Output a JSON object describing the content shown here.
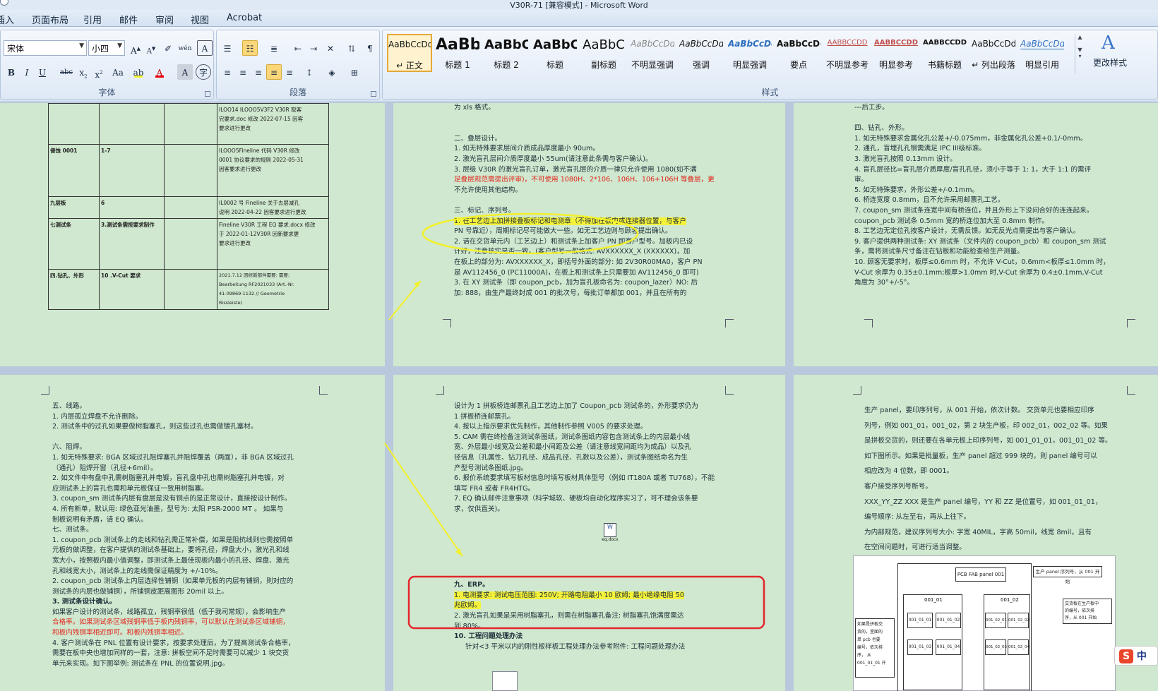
{
  "window": {
    "title": "V30R-71 [兼容模式] - Microsoft Word"
  },
  "tabs": [
    "插入",
    "页面布局",
    "引用",
    "邮件",
    "审阅",
    "视图",
    "Acrobat"
  ],
  "font_group": {
    "font_name": "宋体",
    "font_size": "小四",
    "label": "字体"
  },
  "paragraph_group": {
    "label": "段落"
  },
  "styles_group": {
    "label": "样式",
    "change_styles": "更改样式",
    "items": [
      {
        "sample": "AaBbCcDd",
        "name": "↵ 正文",
        "selected": true
      },
      {
        "sample": "AaBb",
        "name": "标题 1"
      },
      {
        "sample": "AaBbC",
        "name": "标题 2"
      },
      {
        "sample": "AaBbC",
        "name": "标题"
      },
      {
        "sample": "AaBbC",
        "name": "副标题"
      },
      {
        "sample": "AaBbCcDd",
        "name": "不明显强调"
      },
      {
        "sample": "AaBbCcDd",
        "name": "强调"
      },
      {
        "sample": "AaBbCcDd",
        "name": "明显强调"
      },
      {
        "sample": "AaBbCcDd",
        "name": "要点"
      },
      {
        "sample": "AABBCCDD",
        "name": "不明显参考"
      },
      {
        "sample": "AABBCCDD",
        "name": "明显参考"
      },
      {
        "sample": "AABBCCDD",
        "name": "书籍标题"
      },
      {
        "sample": "AaBbCcDd",
        "name": "↵ 列出段落"
      },
      {
        "sample": "AaBbCcDd",
        "name": "明显引用"
      }
    ]
  },
  "page1": {
    "rows": [
      {
        "c1": "",
        "c2": "",
        "c3": "",
        "c4": [
          "ILOO14 ILOOO5V3F2 V30R 取客",
          "完要求.doc 修改 2022-07-15 因客",
          "要求进行更改"
        ]
      },
      {
        "c1": "侵蚀 0001",
        "c2": "1-7",
        "c3": "",
        "c4": [
          "ILOOO5Fineline 代码 V30R 修改",
          "0001 协议要求的规则 2022-05-31",
          "因客要求进行更改"
        ]
      },
      {
        "c1": "九层板",
        "c2": "6",
        "c3": "",
        "c4": [
          "IL0002 号 Fineline 关于去层减孔",
          "说明 2022-04-22 因客要求进行更改"
        ]
      },
      {
        "c1": "七测试条",
        "c2": "3.测试条需按要求制作",
        "c3": "",
        "c4": [
          "Fineline V30R 工程 EQ 要求.docx 修改",
          "于 2022-01-12V30R 因新要求更",
          "要求进行更改"
        ]
      },
      {
        "c1": "四.钻孔、外形",
        "c2": "10 .V-Cut 要求",
        "c3": "",
        "c4": [
          "2021.7.12 因修新部件需要: 需要:",
          "Bearbeitung RF2021033 (Art.-Nr.",
          "41-09869-1132 // Geometrie",
          "Rissleiste)"
        ]
      }
    ]
  },
  "page2": {
    "lines": [
      "为 xls 格式。",
      "",
      "",
      "二、叠层设计。",
      "1. 如无特殊要求层间介质成品厚度最小 90um。",
      "2. 激光盲孔层间介质厚度最小 55um(请注意此条需与客户确认)。",
      "3. 层级 V30R 的激光盲孔订单，激光盲孔层的介质一律只允许使用 1080(如不满",
      "足叠层规范需提出评审)，不可使用 1080H、2*106、106H、106+106H 等叠层，更",
      "不允许使用其他结构。",
      "",
      "三、标记、序列号。",
      "1. 在工艺边上加拼接叠板标记和电测章（不得加在板内或连接器位置，与客户",
      "PN 号靠近），周期标记尽可能做大一些。如无工艺边则与顾客提出确认。",
      "2. 请在交货单元内（工艺边上）和测试条上加客户 PN 即客户型号。加板内已设",
      "计好，注意核实是否一致。(客户型号一般格式: AVXXXXXX_X (XXXXXX)，加",
      "在板上的部分为: AVXXXXXX_X，即括号外面的部分: 如 2V30R00MA0，客户 PN",
      "是 AV112456_0 (PC11000A)，在板上和测试条上只需要加 AV112456_0 即可)",
      "3. 在 XY 测试条（即 coupon_pcb，加为盲孔板命名为: coupon_lazer）NO: 后",
      "加: 888，由生产最终封成 001 的批次号，每批订单都加 001，并且在所有的"
    ]
  },
  "page3": {
    "lines": [
      "---后工步。",
      "",
      "四、钻孔、外形。",
      "1. 如无特殊要求金属化孔公差+/-0.075mm，非金属化孔公差+0.1/-0mm。",
      "2. 通孔，盲埋孔孔钢需满足 IPC III级标准。",
      "3. 激光盲孔按照 0.13mm 设计。",
      "4. 盲孔层径比=盲孔层介质厚度/盲孔孔径，须小于等于 1: 1，大于 1:1 的需评",
      "审。",
      "5. 如无特殊要求，外形公差+/-0.1mm。",
      "6. 桥连宽度 0.8mm，且不允许采用邮票孔工艺。",
      "7. coupon_sm 测试条连宽中间有桥连位，并且外形上下没问合好的连连起来。",
      "coupon_pcb 测试条 0.5mm 宽的桥连位加大至 0.8mm 制作。",
      "8. 工艺边无定位孔按客户设计，无需反馈。如无反光点需提出与客户确认。",
      "9. 客户提供两种测试条: XY 测试条（文件内的 coupon_pcb）和 coupon_sm 测试",
      "条，需将测试条尺寸备注在钻板和功能检查给生产测量。",
      "10. 顾客无要求时，板厚≤0.6mm 时，不允许 V-Cut，0.6mm<板厚≤1.0mm 时，",
      "V-Cut 余厚为 0.35±0.1mm;板厚>1.0mm 时,V-Cut 余厚为 0.4±0.1mm,V-Cut",
      "角度为 30°+/-5°。",
      "",
      ""
    ]
  },
  "page4": {
    "lines": [
      "五、线路。",
      "1. 内层孤立焊盘不允许删除。",
      "2. 测试条中的过孔如果要做树脂塞孔，则这些过孔也需做镀孔塞材。",
      "",
      "六、阻焊。",
      "1. 如无特殊要求: BGA 区域过孔阻焊塞孔并阻焊覆盖（两面），非 BGA 区域过孔",
      "（通孔）阻焊开窗（孔径+6mil）。",
      "2. 如文件中有盘中孔需树脂塞孔并电镀，盲孔盘中孔也需树脂塞孔并电镀，对",
      "应测试条上的盲孔也需和单元板保证一致用树脂塞。",
      "3. coupon_sm 测试条内层有盘层是没有铜点的是正常设计，直接按设计制作。",
      "4. 所有新单，默认用: 绿色亚光油墨，型号为: 太阳 PSR-2000 MT 。 如果与",
      "制板说明有矛盾，请 EQ 确认。",
      "七、测试条。",
      "1. coupon_pcb 测试条上的走线和钻孔需正常补偿，如果是阻抗线则也需按照单",
      "元板的做调整，在客户提供的测试条基础上，要将孔径，焊盘大小，激光孔和线",
      "宽大小，按照板内最小值调整，即测试条上最佳现板内最小的孔径、焊盘、激光",
      "孔和线宽大小，测试条上的走线需保证精度为 +/-10%。",
      "2. coupon_pcb 测试条上内层选择性铺铜（如果单元板的内层有铺铜，则对应的",
      "测试条的内层也做铺铜），所铺铜皮距离图形 20mil 以上。",
      "3. 测试条设计确认。",
      "如果客户设计的测试条，线路孤立，残铜率很低（低于我司常规），会影响生产",
      "合格率。如果测试条区域残铜率低于板内残铜率，可以默认在测试条区域铺铜，",
      "和板内残铜率相近即可。和板内残铜率相近。",
      "4. 客户测试条在 PNL 位置有设计要求，按要求处理后，为了提高测试条合格率，",
      "需要在板中央也增加同样的一套，注意: 拼板空间不足时需要可以减少 1 块交货",
      "单元来实现。如下图举例: 测试条在 PNL 的位置说明.jpg。"
    ]
  },
  "page5": {
    "lines": [
      "设计为 1 拼板桥连邮票孔且工艺边上加了 Coupon_pcb 测试条的，外形要求仍为",
      "1 拼板桥连邮票孔。",
      "4. 按以上指示要求优先制作，其他制作参照 V005 的要求处理。",
      "5. CAM 需在终检备注测试条图纸，测试条图纸内容包含测试条上的内层最小线",
      "宽、外层最小线宽及公差和最小间距及公差（请注意线宽间距均为成品）以及孔",
      "径信息（孔属性、钻刀孔径、成品孔径、孔数以及公差），测试条图纸命名为生",
      "产型号测试条图纸.jpg。",
      "6. 报价系统要求填写板材信息时填写板材具体型号（例如 IT180A 或者 TU768），不能",
      "填写 FR4 或者 FR4HTG。",
      "7. EQ 确认邮件注意事项（科学城软、硬板均自动化程序实习了，可不理会该条要",
      "求，仅供直关)。"
    ],
    "embed_label": "eq.docx",
    "lines2": [
      "",
      "",
      "九、ERP。",
      "1. 电测要求: 测试电压范围: 250V; 开路电阻最小 10 欧姆; 最小绝缘电阻 50",
      "兆欧姆。",
      "2. 激光盲孔如果是采用树脂塞孔，则需在树脂塞孔备注: 树脂塞孔饱满度需达",
      "到 80%。",
      "10. 工程问题处理办法",
      "针对<3 平米以内的刚性板样板工程处理办法参考附件: 工程问题处理办法"
    ]
  },
  "page6": {
    "lines": [
      "生产 panel，要印序列号，从 001 开始，依次计数。 交货单元也要相应印序",
      "列号，例如 001_01，001_02，第 2 块生产板，印 002_01，002_02 等。如果",
      "是拼板交货的，则还要在各单元板上印序列号，如 001_01_01，001_01_02 等。",
      "如下图所示。如果是批量板，生产 panel 超过 999 块的，则 panel 编号可以",
      "相应改为 4 位数，即 0001。",
      "客户接受序列号断号。",
      "XXX_YY_ZZ  XXX 是生产 panel 编号，YY 和 ZZ 是位置号，如 001_01_01，",
      "编号顺序: 从左至右，再从上往下。",
      "为内部规范，建议序列号大小: 字宽 40MIL，字高 50mil，线宽 8mil，且有",
      "在空间问题时，可进行适当调整。"
    ],
    "diagram": {
      "panel_title": "PCB FAB panel 001",
      "note_top": "生产 panel 序列号，从 001 开始",
      "unit1": "001_01",
      "unit2": "001_02",
      "note_right": [
        "交货板在生产板中",
        "的编号，依次排",
        "序，从 001 开始"
      ],
      "note_left": [
        "如果是拼板交",
        "货的，里面的",
        "单 pcb 也要",
        "编号，依次排",
        "序， 从",
        "001_01_01 开"
      ],
      "cells": [
        "001_01_01",
        "001_01_02",
        "001_01_03",
        "001_01_04",
        "001_02_01",
        "001_02_02",
        "001_02_03",
        "001_02_04"
      ]
    }
  },
  "ime": {
    "label": "中"
  }
}
